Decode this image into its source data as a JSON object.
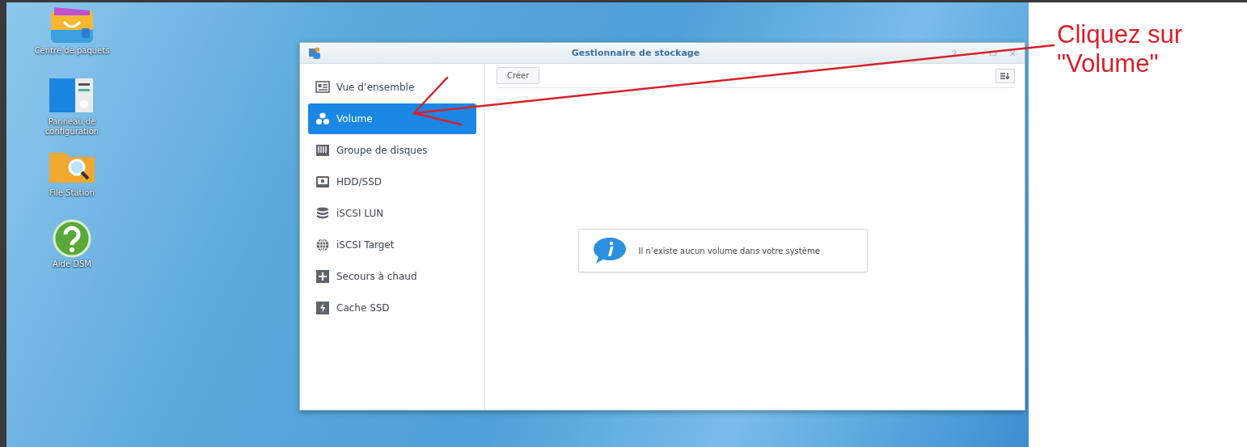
{
  "desktop_icons": [
    {
      "kind": "package",
      "label": "Centre de paquets"
    },
    {
      "kind": "control-panel",
      "label": "Panneau de configuration"
    },
    {
      "kind": "folder",
      "label": "File Station"
    },
    {
      "kind": "help",
      "label": "Aide DSM"
    }
  ],
  "window": {
    "title": "Gestionnaire de stockage"
  },
  "sidebar": {
    "items": [
      {
        "kind": "overview",
        "label": "Vue d’ensemble",
        "selected": false
      },
      {
        "kind": "volume",
        "label": "Volume",
        "selected": true
      },
      {
        "kind": "disk-group",
        "label": "Groupe de disques",
        "selected": false
      },
      {
        "kind": "hdd",
        "label": "HDD/SSD",
        "selected": false
      },
      {
        "kind": "lun",
        "label": "iSCSI LUN",
        "selected": false
      },
      {
        "kind": "target",
        "label": "iSCSI Target",
        "selected": false
      },
      {
        "kind": "hotspare",
        "label": "Secours à chaud",
        "selected": false
      },
      {
        "kind": "cache",
        "label": "Cache SSD",
        "selected": false
      }
    ]
  },
  "toolbar": {
    "create_button": "Créer"
  },
  "empty_message": "Il n’existe aucun volume dans votre système",
  "annotation": "Cliquez sur \"Volume\""
}
